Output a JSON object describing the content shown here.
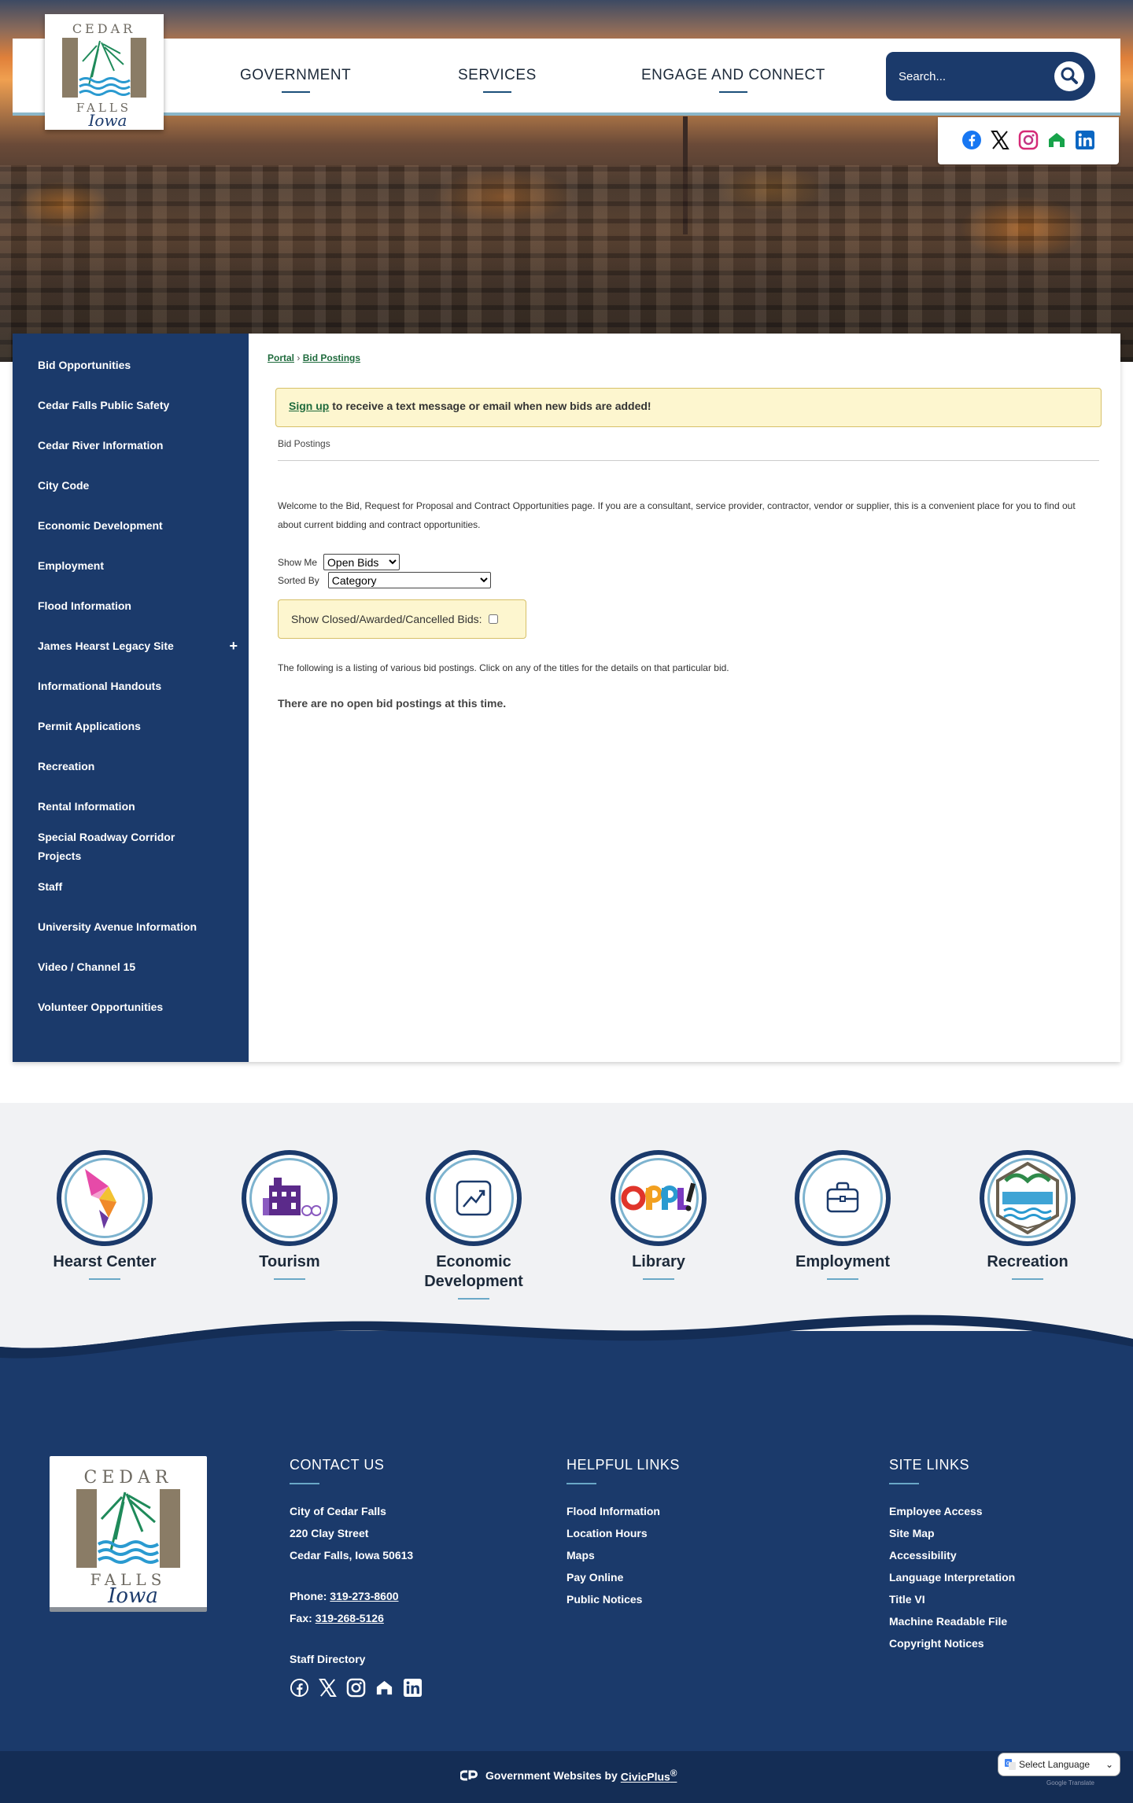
{
  "header": {
    "logo_alt": "CEDAR FALLS Iowa",
    "nav": [
      "GOVERNMENT",
      "SERVICES",
      "ENGAGE AND CONNECT"
    ],
    "search_placeholder": "Search...",
    "social_icons": [
      "facebook-icon",
      "x-icon",
      "instagram-icon",
      "nextdoor-icon",
      "linkedin-icon"
    ]
  },
  "sidebar": {
    "items": [
      {
        "label": "Bid Opportunities"
      },
      {
        "label": "Cedar Falls Public Safety"
      },
      {
        "label": "Cedar River Information"
      },
      {
        "label": "City Code"
      },
      {
        "label": "Economic Development"
      },
      {
        "label": "Employment"
      },
      {
        "label": "Flood Information"
      },
      {
        "label": "James Hearst Legacy Site",
        "expand": "+"
      },
      {
        "label": "Informational Handouts"
      },
      {
        "label": "Permit Applications"
      },
      {
        "label": "Recreation"
      },
      {
        "label": "Rental Information"
      },
      {
        "label": "Special Roadway Corridor Projects"
      },
      {
        "label": "Staff"
      },
      {
        "label": "University Avenue Information"
      },
      {
        "label": "Video / Channel 15"
      },
      {
        "label": "Volunteer Opportunities"
      }
    ]
  },
  "main": {
    "breadcrumb": {
      "portal": "Portal",
      "sep": "›",
      "current": "Bid Postings"
    },
    "signup": {
      "link": "Sign up",
      "text": " to receive a text message or email when new bids are added!"
    },
    "module_title": "Bid Postings",
    "welcome": "Welcome to the Bid, Request for Proposal and Contract Opportunities page. If you are a consultant, service provider, contractor, vendor or supplier, this is a convenient place for you to find out about current bidding and contract opportunities.",
    "show_me_label": "Show Me",
    "show_me_value": "Open Bids",
    "sorted_by_label": "Sorted By",
    "sorted_by_value": "Category",
    "closed_label": "Show Closed/Awarded/Cancelled Bids:",
    "listing_text": "The following is a listing of various bid postings. Click on any of the titles for the details on that particular bid.",
    "no_bids": "There are no open bid postings at this time."
  },
  "quick_links": [
    {
      "label": "Hearst Center"
    },
    {
      "label": "Tourism"
    },
    {
      "label": "Economic Development"
    },
    {
      "label": "Library"
    },
    {
      "label": "Employment"
    },
    {
      "label": "Recreation"
    }
  ],
  "footer": {
    "contact": {
      "title": "CONTACT US",
      "name": "City of Cedar Falls",
      "street": "220 Clay Street",
      "city": "Cedar Falls, Iowa 50613",
      "phone_label": "Phone: ",
      "phone": "319-273-8600",
      "fax_label": "Fax: ",
      "fax": "319-268-5126",
      "staff_directory": "Staff Directory"
    },
    "helpful": {
      "title": "HELPFUL LINKS",
      "links": [
        "Flood Information",
        "Location Hours",
        "Maps",
        "Pay Online",
        "Public Notices"
      ]
    },
    "site": {
      "title": "SITE LINKS",
      "links": [
        "Employee Access",
        "Site Map",
        "Accessibility",
        "Language Interpretation",
        "Title VI",
        "Machine Readable File",
        "Copyright Notices"
      ]
    }
  },
  "bottom": {
    "text": "Government Websites by ",
    "brand": "CivicPlus",
    "reg": "®",
    "language": "Select Language",
    "powered": "Google Translate"
  },
  "colors": {
    "navy": "#1b3a6b",
    "highlight": "#fdf6cf",
    "link_green": "#1f6b3d",
    "accent_blue": "#6aa8c7"
  }
}
